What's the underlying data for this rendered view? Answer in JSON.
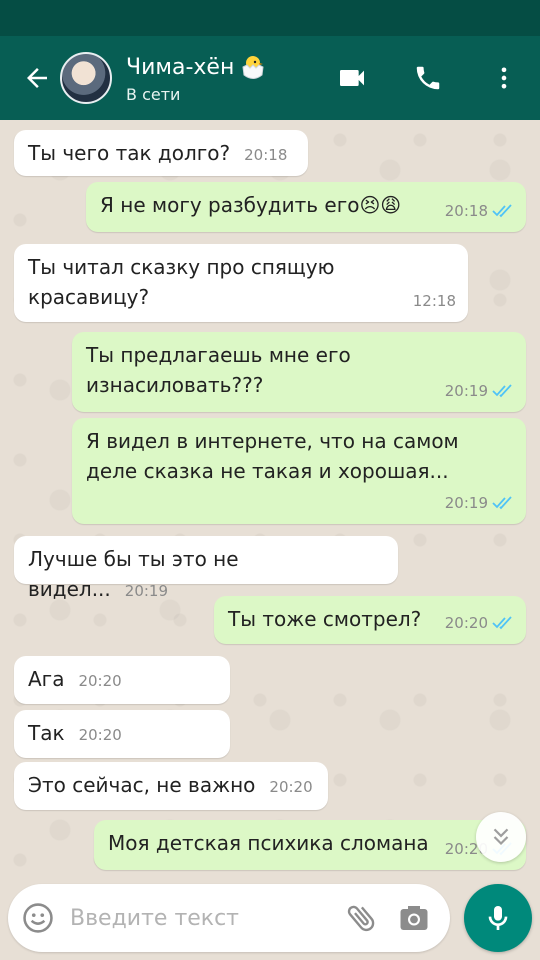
{
  "header": {
    "contact_name": "Чима-хён",
    "contact_status": "В сети"
  },
  "messages": [
    {
      "direction": "in",
      "text": "Ты чего так долго?",
      "time": "20:18"
    },
    {
      "direction": "out",
      "text": "Я не могу разбудить его😣😩",
      "time": "20:18",
      "read": true
    },
    {
      "direction": "in",
      "text": "Ты читал сказку про спящую красавицу?",
      "time": "12:18"
    },
    {
      "direction": "out",
      "text": "Ты предлагаешь мне его изнасиловать???",
      "time": "20:19",
      "read": true
    },
    {
      "direction": "out",
      "text": "Я видел в интернете, что на самом деле сказка не такая и хорошая...",
      "time": "20:19",
      "read": true
    },
    {
      "direction": "in",
      "text": "Лучше бы ты это не видел...",
      "time": "20:19"
    },
    {
      "direction": "out",
      "text": "Ты тоже смотрел?",
      "time": "20:20",
      "read": true
    },
    {
      "direction": "in",
      "text": "Ага",
      "time": "20:20"
    },
    {
      "direction": "in",
      "text": "Так",
      "time": "20:20"
    },
    {
      "direction": "in",
      "text": "Это сейчас, не важно",
      "time": "20:20"
    },
    {
      "direction": "out",
      "text": "Моя детская психика сломана",
      "time": "20:20",
      "read": true
    }
  ],
  "input": {
    "placeholder": "Введите текст"
  },
  "icons": {
    "back": "arrow-left-icon",
    "video": "video-call-icon",
    "call": "phone-icon",
    "menu": "more-vert-icon",
    "emoji": "emoji-icon",
    "attach": "paperclip-icon",
    "camera": "camera-icon",
    "mic": "microphone-icon",
    "scroll": "double-chevron-down-icon"
  },
  "colors": {
    "app_bar": "#075e54",
    "status_bar": "#054d44",
    "outgoing_bubble": "#dcf8c6",
    "incoming_bubble": "#ffffff",
    "read_ticks": "#4fc3f7",
    "accent": "#00897b"
  }
}
